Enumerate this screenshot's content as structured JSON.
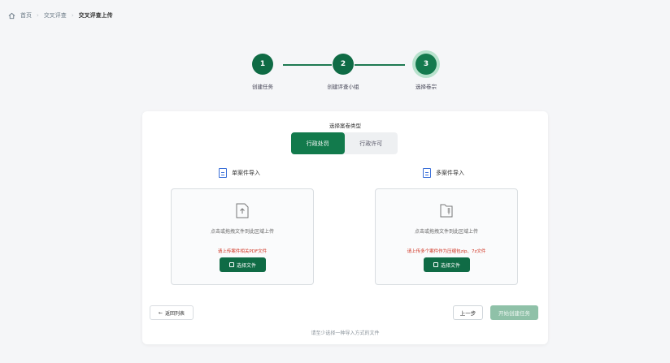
{
  "breadcrumb": {
    "home": "首页",
    "level2": "交叉评查",
    "current": "交叉评查上传"
  },
  "steps": [
    {
      "number": "1",
      "label": "创建任务"
    },
    {
      "number": "2",
      "label": "创建评查小组"
    },
    {
      "number": "3",
      "label": "选择卷宗"
    }
  ],
  "case_type": {
    "title": "选择案卷类型",
    "options": [
      "行政处罚",
      "行政许可"
    ],
    "selected": "行政处罚"
  },
  "single_import": {
    "title": "单案件导入",
    "drop_text": "点击或拖拽文件到此区域上传",
    "hint": "请上传案件相关PDF文件",
    "button": "选择文件"
  },
  "multi_import": {
    "title": "多案件导入",
    "drop_text": "点击或拖拽文件到此区域上传",
    "hint": "请上传多个案件作为压缩包zip、7z文件",
    "button": "选择文件"
  },
  "actions": {
    "back": "返回列表",
    "prev": "上一步",
    "start": "开始创建任务"
  },
  "footer_hint": "请至少选择一种导入方式的文件",
  "colors": {
    "primary": "#0f6b45",
    "disabled": "#8fc1a8",
    "error": "#d0311f",
    "icon_blue": "#3a6fd8"
  }
}
